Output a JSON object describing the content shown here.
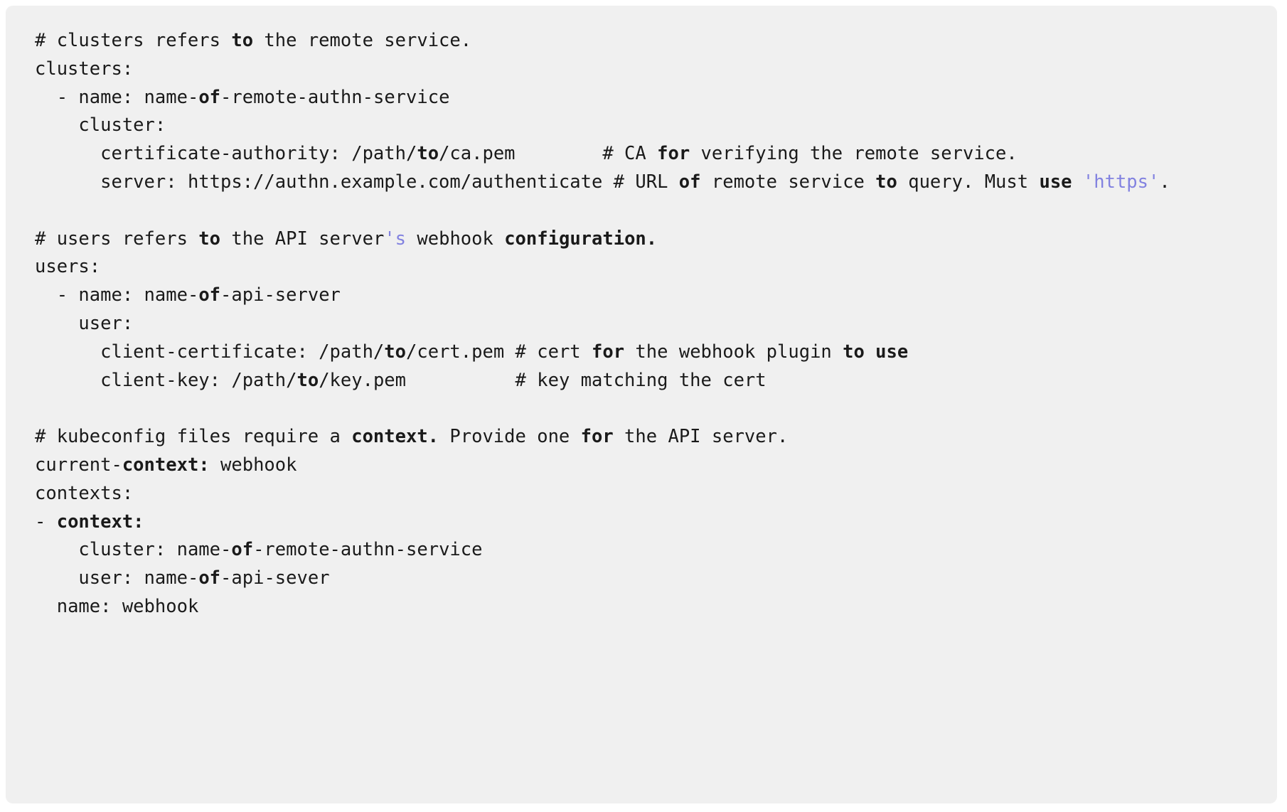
{
  "code_block": {
    "language": "yaml",
    "background_color": "#f0f0f0",
    "text_color": "#1a1a1a",
    "string_color": "#8282e0",
    "lines": [
      {
        "id": "line-1",
        "text": "# clusters refers to the remote service.",
        "tokens": [
          {
            "t": "# clusters refers ",
            "k": "plain"
          },
          {
            "t": "to",
            "k": "bold"
          },
          {
            "t": " the remote service.",
            "k": "plain"
          }
        ]
      },
      {
        "id": "line-2",
        "text": "clusters:",
        "tokens": [
          {
            "t": "clusters:",
            "k": "plain"
          }
        ]
      },
      {
        "id": "line-3",
        "text": "  - name: name-of-remote-authn-service",
        "tokens": [
          {
            "t": "  - name: name-",
            "k": "plain"
          },
          {
            "t": "of",
            "k": "bold"
          },
          {
            "t": "-remote-authn-service",
            "k": "plain"
          }
        ]
      },
      {
        "id": "line-4",
        "text": "    cluster:",
        "tokens": [
          {
            "t": "    cluster:",
            "k": "plain"
          }
        ]
      },
      {
        "id": "line-5",
        "text": "      certificate-authority: /path/to/ca.pem        # CA for verifying the remote service.",
        "tokens": [
          {
            "t": "      certificate-authority: /path/",
            "k": "plain"
          },
          {
            "t": "to",
            "k": "bold"
          },
          {
            "t": "/ca.pem        # CA ",
            "k": "plain"
          },
          {
            "t": "for",
            "k": "bold"
          },
          {
            "t": " verifying the remote service.",
            "k": "plain"
          }
        ]
      },
      {
        "id": "line-6",
        "text": "      server: https://authn.example.com/authenticate # URL of remote service to query. Must use 'https'.",
        "tokens": [
          {
            "t": "      server: https://authn.example.com/authenticate # URL ",
            "k": "plain"
          },
          {
            "t": "of",
            "k": "bold"
          },
          {
            "t": " remote service ",
            "k": "plain"
          },
          {
            "t": "to",
            "k": "bold"
          },
          {
            "t": " query. Must ",
            "k": "plain"
          },
          {
            "t": "use",
            "k": "bold"
          },
          {
            "t": " ",
            "k": "plain"
          },
          {
            "t": "'https'",
            "k": "string"
          },
          {
            "t": ".",
            "k": "plain"
          }
        ]
      },
      {
        "id": "line-7",
        "text": "",
        "tokens": []
      },
      {
        "id": "line-8",
        "text": "# users refers to the API server's webhook configuration.",
        "tokens": [
          {
            "t": "# users refers ",
            "k": "plain"
          },
          {
            "t": "to",
            "k": "bold"
          },
          {
            "t": " the API server",
            "k": "plain"
          },
          {
            "t": "'s",
            "k": "string"
          },
          {
            "t": " webhook ",
            "k": "plain"
          },
          {
            "t": "configuration.",
            "k": "bold"
          }
        ]
      },
      {
        "id": "line-9",
        "text": "users:",
        "tokens": [
          {
            "t": "users:",
            "k": "plain"
          }
        ]
      },
      {
        "id": "line-10",
        "text": "  - name: name-of-api-server",
        "tokens": [
          {
            "t": "  - name: name-",
            "k": "plain"
          },
          {
            "t": "of",
            "k": "bold"
          },
          {
            "t": "-api-server",
            "k": "plain"
          }
        ]
      },
      {
        "id": "line-11",
        "text": "    user:",
        "tokens": [
          {
            "t": "    user:",
            "k": "plain"
          }
        ]
      },
      {
        "id": "line-12",
        "text": "      client-certificate: /path/to/cert.pem # cert for the webhook plugin to use",
        "tokens": [
          {
            "t": "      client-certificate: /path/",
            "k": "plain"
          },
          {
            "t": "to",
            "k": "bold"
          },
          {
            "t": "/cert.pem # cert ",
            "k": "plain"
          },
          {
            "t": "for",
            "k": "bold"
          },
          {
            "t": " the webhook plugin ",
            "k": "plain"
          },
          {
            "t": "to use",
            "k": "bold"
          }
        ]
      },
      {
        "id": "line-13",
        "text": "      client-key: /path/to/key.pem          # key matching the cert",
        "tokens": [
          {
            "t": "      client-key: /path/",
            "k": "plain"
          },
          {
            "t": "to",
            "k": "bold"
          },
          {
            "t": "/key.pem          # key matching the cert",
            "k": "plain"
          }
        ]
      },
      {
        "id": "line-14",
        "text": "",
        "tokens": []
      },
      {
        "id": "line-15",
        "text": "# kubeconfig files require a context. Provide one for the API server.",
        "tokens": [
          {
            "t": "# kubeconfig files require a ",
            "k": "plain"
          },
          {
            "t": "context.",
            "k": "bold"
          },
          {
            "t": " Provide one ",
            "k": "plain"
          },
          {
            "t": "for",
            "k": "bold"
          },
          {
            "t": " the API server.",
            "k": "plain"
          }
        ]
      },
      {
        "id": "line-16",
        "text": "current-context: webhook",
        "tokens": [
          {
            "t": "current-",
            "k": "plain"
          },
          {
            "t": "context:",
            "k": "bold"
          },
          {
            "t": " webhook",
            "k": "plain"
          }
        ]
      },
      {
        "id": "line-17",
        "text": "contexts:",
        "tokens": [
          {
            "t": "contexts:",
            "k": "plain"
          }
        ]
      },
      {
        "id": "line-18",
        "text": "- context:",
        "tokens": [
          {
            "t": "- ",
            "k": "plain"
          },
          {
            "t": "context:",
            "k": "bold"
          }
        ]
      },
      {
        "id": "line-19",
        "text": "    cluster: name-of-remote-authn-service",
        "tokens": [
          {
            "t": "    cluster: name-",
            "k": "plain"
          },
          {
            "t": "of",
            "k": "bold"
          },
          {
            "t": "-remote-authn-service",
            "k": "plain"
          }
        ]
      },
      {
        "id": "line-20",
        "text": "    user: name-of-api-sever",
        "tokens": [
          {
            "t": "    user: name-",
            "k": "plain"
          },
          {
            "t": "of",
            "k": "bold"
          },
          {
            "t": "-api-sever",
            "k": "plain"
          }
        ]
      },
      {
        "id": "line-21",
        "text": "  name: webhook",
        "tokens": [
          {
            "t": "  name: webhook",
            "k": "plain"
          }
        ]
      }
    ]
  }
}
